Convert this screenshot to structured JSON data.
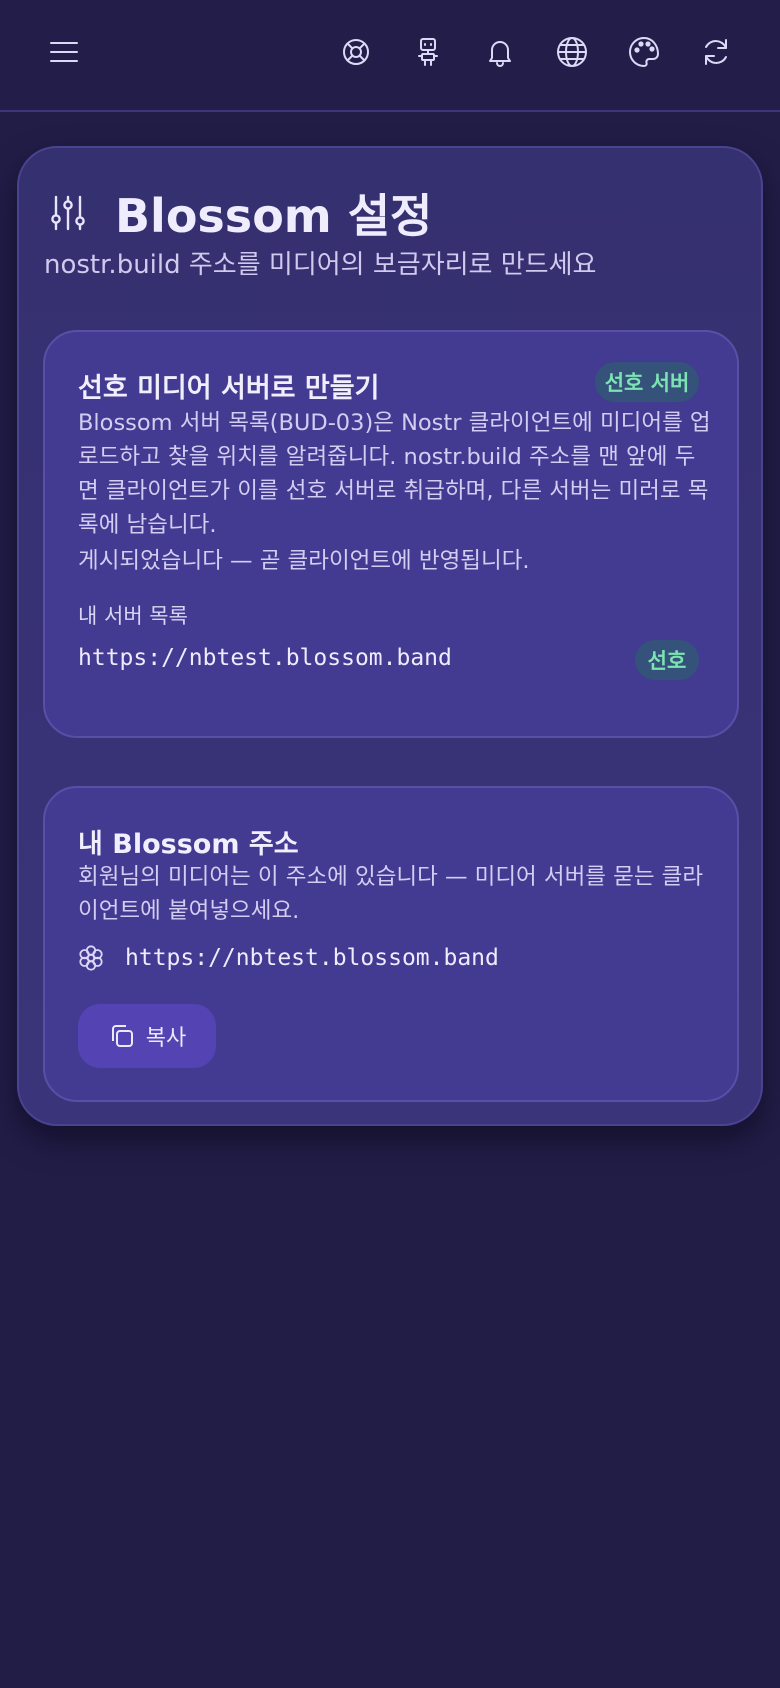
{
  "header": {
    "menu_icon": "hamburger-menu-icon",
    "actions": [
      {
        "icon": "lifebuoy-icon"
      },
      {
        "icon": "robot-icon"
      },
      {
        "icon": "bell-icon"
      },
      {
        "icon": "globe-icon"
      },
      {
        "icon": "palette-icon"
      },
      {
        "icon": "refresh-icon"
      }
    ]
  },
  "page": {
    "title": "Blossom 설정",
    "subtitle": "nostr.build 주소를 미디어의 보금자리로 만드세요",
    "title_icon": "sliders-icon"
  },
  "preferred_card": {
    "title": "선호 미디어 서버로 만들기",
    "badge": "선호 서버",
    "description": "Blossom 서버 목록(BUD-03)은 Nostr 클라이언트에 미디어를 업로드하고 찾을 위치를 알려줍니다. nostr.build 주소를 맨 앞에 두면 클라이언트가 이를 선호 서버로 취급하며, 다른 서버는 미러로 목록에 남습니다.",
    "status": "게시되었습니다 — 곧 클라이언트에 반영됩니다.",
    "server_list_label": "내 서버 목록",
    "servers": [
      {
        "url": "https://nbtest.blossom.band",
        "badge": "선호"
      }
    ]
  },
  "address_card": {
    "title": "내 Blossom 주소",
    "description": "회원님의 미디어는 이 주소에 있습니다 — 미디어 서버를 묻는 클라이언트에 붙여넣으세요.",
    "address": "https://nbtest.blossom.band",
    "address_icon": "flower-icon",
    "copy_label": "복사",
    "copy_icon": "copy-icon"
  },
  "colors": {
    "background": "#221d47",
    "card": "#433b92",
    "badge_bg": "#35527a",
    "badge_text": "#7ce3b2",
    "button": "#5443b3"
  }
}
